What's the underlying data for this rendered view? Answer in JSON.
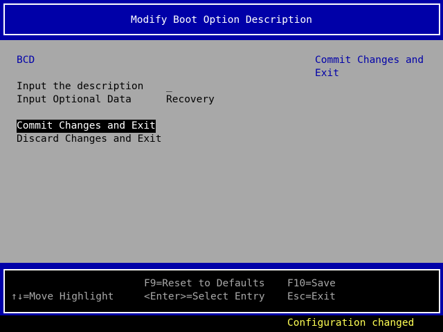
{
  "title": "Modify Boot Option Description",
  "form": {
    "heading": "BCD",
    "fields": [
      {
        "label": "Input the description",
        "value": "_"
      },
      {
        "label": "Input Optional Data",
        "value": "Recovery"
      }
    ],
    "actions": [
      {
        "label": "Commit Changes and Exit"
      },
      {
        "label": "Discard Changes and Exit"
      }
    ]
  },
  "help_panel": {
    "line1": "Commit Changes and",
    "line2": "Exit"
  },
  "footer": {
    "move_highlight": "↑↓=Move Highlight",
    "reset_defaults": "F9=Reset to Defaults",
    "select_entry": "<Enter>=Select Entry",
    "save": "F10=Save",
    "exit": "Esc=Exit"
  },
  "status": {
    "message": "Configuration changed"
  },
  "colors": {
    "title_bg": "#0000a8",
    "main_bg": "#a8a8a8",
    "highlight_bg": "#000000",
    "status_text": "#ffff54"
  }
}
